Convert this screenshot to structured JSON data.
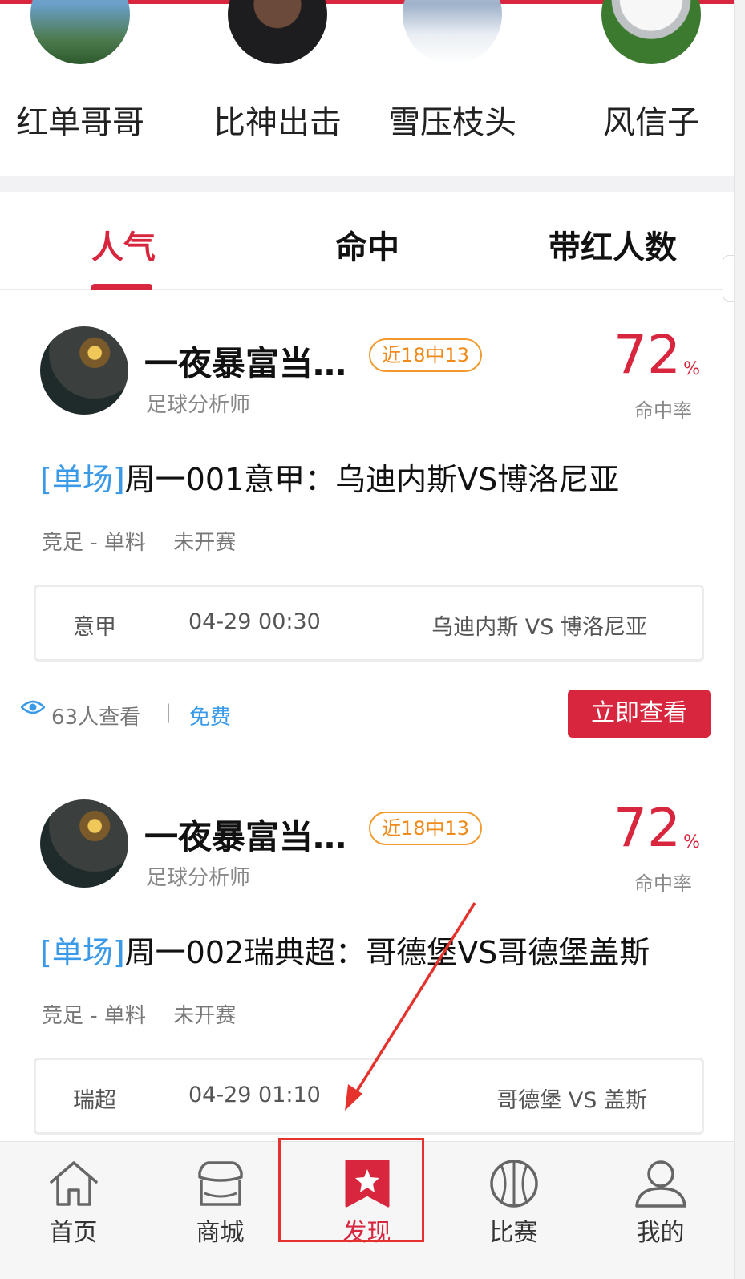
{
  "colors": {
    "accent": "#d7263d",
    "link_blue": "#3b9ae8",
    "badge_orange": "#f08a1b",
    "annotation_red": "#e5322d"
  },
  "experts": [
    {
      "name": "红单哥哥",
      "avatar": "city-skyline-avatar"
    },
    {
      "name": "比神出击",
      "avatar": "basketball-player-avatar"
    },
    {
      "name": "雪压枝头",
      "avatar": "snow-scene-avatar"
    },
    {
      "name": "风信子",
      "avatar": "soccer-ball-avatar"
    }
  ],
  "tabs": [
    {
      "label": "人气",
      "active": true
    },
    {
      "label": "命中",
      "active": false
    },
    {
      "label": "带红人数",
      "active": false
    }
  ],
  "cards": [
    {
      "author": "一夜暴富当…",
      "record": "近18中13",
      "role": "足球分析师",
      "hit_rate": "72",
      "hit_rate_unit": "%",
      "hit_rate_label": "命中率",
      "tag": "[单场]",
      "title": "周一001意甲：乌迪内斯VS博洛尼亚",
      "category": "竞足 - 单料",
      "status": "未开赛",
      "league": "意甲",
      "time": "04-29 00:30",
      "teams": "乌迪内斯 VS 博洛尼亚",
      "views": "63人查看",
      "separator": "|",
      "price": "免费",
      "button": "立即查看"
    },
    {
      "author": "一夜暴富当…",
      "record": "近18中13",
      "role": "足球分析师",
      "hit_rate": "72",
      "hit_rate_unit": "%",
      "hit_rate_label": "命中率",
      "tag": "[单场]",
      "title": "周一002瑞典超：哥德堡VS哥德堡盖斯",
      "category": "竞足 - 单料",
      "status": "未开赛",
      "league": "瑞超",
      "time": "04-29 01:10",
      "teams": "哥德堡 VS 盖斯"
    }
  ],
  "bottom_nav": [
    {
      "label": "首页",
      "icon": "home-icon",
      "active": false
    },
    {
      "label": "商城",
      "icon": "store-icon",
      "active": false
    },
    {
      "label": "发现",
      "icon": "discover-star-icon",
      "active": true
    },
    {
      "label": "比赛",
      "icon": "basketball-icon",
      "active": false
    },
    {
      "label": "我的",
      "icon": "user-icon",
      "active": false
    }
  ]
}
